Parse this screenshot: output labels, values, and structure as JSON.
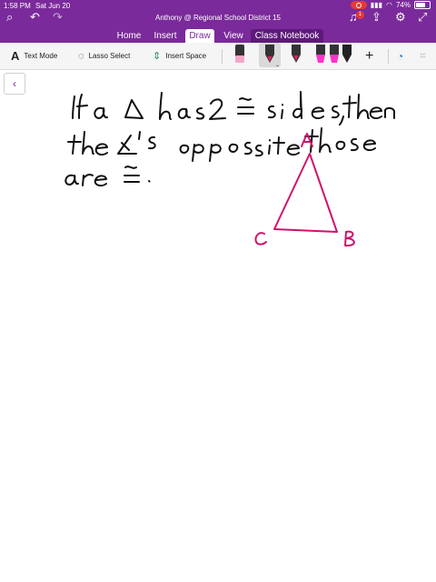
{
  "status": {
    "time": "1:58 PM",
    "date": "Sat Jun 20",
    "battery": "74%",
    "notification_count": "1"
  },
  "window": {
    "title": "Anthony @ Regional School District 15"
  },
  "tabs": [
    {
      "label": "Home"
    },
    {
      "label": "Insert"
    },
    {
      "label": "Draw"
    },
    {
      "label": "View"
    },
    {
      "label": "Class Notebook"
    }
  ],
  "active_tab": "Draw",
  "toolbar": {
    "text_mode": "Text Mode",
    "lasso_select": "Lasso Select",
    "insert_space": "Insert Space"
  },
  "pens": [
    {
      "kind": "eraser",
      "color": "#f4a6c8"
    },
    {
      "kind": "pen",
      "color": "#e0245e"
    },
    {
      "kind": "pen",
      "color": "#e0245e"
    },
    {
      "kind": "highlighter",
      "color": "#ff33cc"
    },
    {
      "kind": "highlighter",
      "color": "#ff33cc"
    },
    {
      "kind": "pen",
      "color": "#222222"
    }
  ],
  "colors": {
    "brand": "#7a2a9a",
    "ink": "#111111",
    "triangle": "#d1126b"
  }
}
